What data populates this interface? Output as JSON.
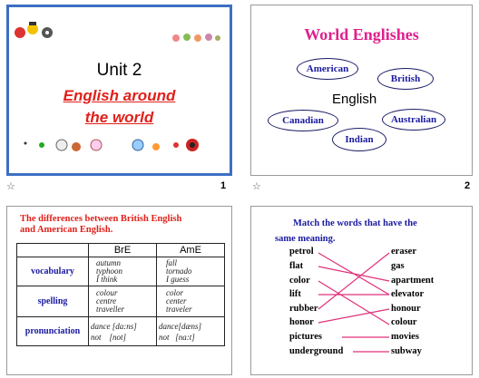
{
  "slide1": {
    "unit": "Unit 2",
    "title_line1": "English around",
    "title_line2": "the world",
    "number": "1"
  },
  "slide2": {
    "title": "World Englishes",
    "center": "English",
    "ovals": [
      "American",
      "British",
      "Canadian",
      "Australian",
      "Indian"
    ],
    "number": "2"
  },
  "slide3": {
    "title_line1": "The differences between British English",
    "title_line2": "and American English.",
    "headers": [
      "BrE",
      "AmE"
    ],
    "rows": [
      {
        "label": "vocabulary",
        "bre": [
          "autumn",
          "typhoon",
          "I think"
        ],
        "ame": [
          "fall",
          "tornado",
          "I guess"
        ]
      },
      {
        "label": "spelling",
        "bre": [
          "colour",
          "centre",
          "traveller"
        ],
        "ame": [
          "color",
          "center",
          "traveler"
        ]
      },
      {
        "label": "pronunciation",
        "bre": [
          "dance [da:ns]",
          "not    [not]"
        ],
        "ame": [
          "dance[dæns]",
          "not   [na:t]"
        ]
      }
    ]
  },
  "slide4": {
    "title_line1": "Match the words that have the",
    "title_line2": "same meaning.",
    "left": [
      "petrol",
      "flat",
      "color",
      "lift",
      "rubber",
      "honor",
      "pictures",
      "underground"
    ],
    "right": [
      "eraser",
      "gas",
      "apartment",
      "elevator",
      "honour",
      "colour",
      "movies",
      "subway"
    ],
    "line_color": "#e0307a"
  },
  "accents": {
    "frame": "#3d6fc4",
    "title_red": "#e0201a",
    "title_magenta": "#e0208c",
    "label_blue": "#1a1aa0"
  }
}
